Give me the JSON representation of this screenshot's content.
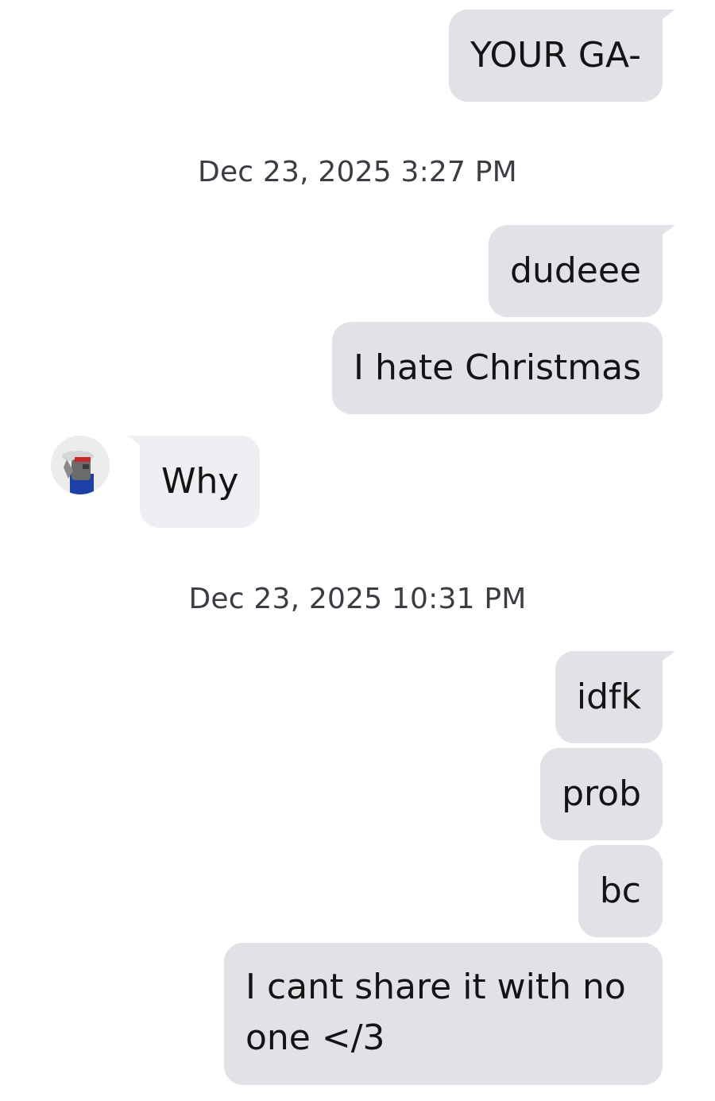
{
  "colors": {
    "outgoing_bubble": "#e1e2e7",
    "incoming_bubble": "#efeff3",
    "text": "#141414",
    "timestamp": "#3a3d44",
    "background": "#ffffff"
  },
  "messages": [
    {
      "sender": "me",
      "text": "YOUR GA-"
    },
    {
      "type": "timestamp",
      "text": "Dec 23, 2025 3:27 PM"
    },
    {
      "sender": "me",
      "text": "dudeee"
    },
    {
      "sender": "me",
      "text": "I hate Christmas"
    },
    {
      "sender": "contact",
      "text": "Why",
      "avatar_icon": "roblox-avatar-icon"
    },
    {
      "type": "timestamp",
      "text": "Dec 23, 2025 10:31 PM"
    },
    {
      "sender": "me",
      "text": "idfk"
    },
    {
      "sender": "me",
      "text": "prob"
    },
    {
      "sender": "me",
      "text": "bc"
    },
    {
      "sender": "me",
      "text": "I cant share it with no one </3"
    }
  ]
}
